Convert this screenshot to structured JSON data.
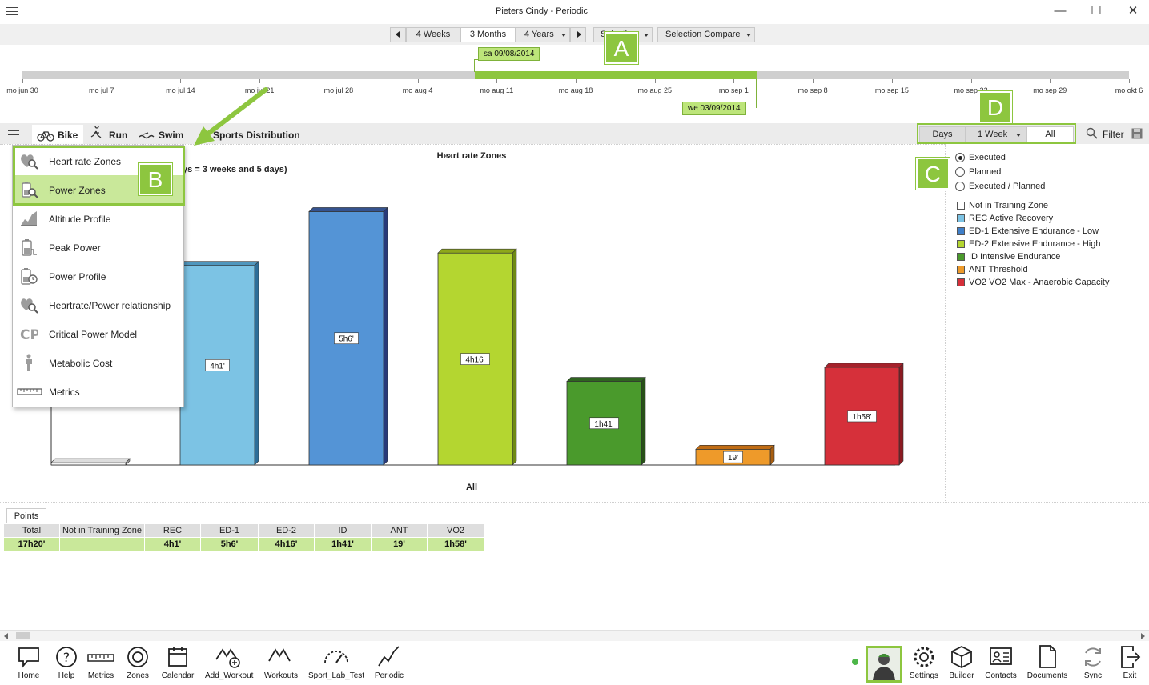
{
  "window": {
    "title": "Pieters Cindy - Periodic"
  },
  "range": {
    "segments": [
      "4 Weeks",
      "3 Months",
      "4 Years"
    ],
    "select_label": "Selection",
    "compare_label": "Selection Compare"
  },
  "timeline": {
    "start_date": "sa 09/08/2014",
    "end_date": "we 03/09/2014",
    "ticks": [
      "mo jun 30",
      "mo jul 7",
      "mo jul 14",
      "mo jul 21",
      "mo jul 28",
      "mo aug 4",
      "mo aug 11",
      "mo aug 18",
      "mo aug 25",
      "mo sep 1",
      "mo sep 8",
      "mo sep 15",
      "mo sep 22",
      "mo sep 29",
      "mo okt 6"
    ]
  },
  "callouts": {
    "a": "A",
    "b": "B",
    "c": "C",
    "d": "D"
  },
  "tabs": {
    "bike": "Bike",
    "run": "Run",
    "swim": "Swim",
    "sports": "Sports Distribution"
  },
  "grouping": {
    "days": "Days",
    "week": "1 Week",
    "all": "All",
    "filter": "Filter"
  },
  "menu": {
    "items": [
      {
        "label": "Heart rate Zones",
        "icon": "heart-magnifier-icon"
      },
      {
        "label": "Power Zones",
        "icon": "battery-magnifier-icon"
      },
      {
        "label": "Altitude Profile",
        "icon": "altitude-chart-icon"
      },
      {
        "label": "Peak Power",
        "icon": "battery-peak-icon"
      },
      {
        "label": "Power Profile",
        "icon": "battery-clock-icon"
      },
      {
        "label": "Heartrate/Power relationship",
        "icon": "heart-power-icon"
      },
      {
        "label": "Critical Power Model",
        "icon": "cp-icon"
      },
      {
        "label": "Metabolic Cost",
        "icon": "person-icon"
      },
      {
        "label": "Metrics",
        "icon": "ruler-icon"
      }
    ]
  },
  "chart_data": {
    "type": "bar",
    "title": "Heart rate Zones",
    "subtitle": "ys = 3 weeks and 5 days)",
    "xlabel": "All",
    "ylabel": "",
    "categories": [
      "Not in Training Zone",
      "REC",
      "ED-1",
      "ED-2",
      "ID",
      "ANT",
      "VO2"
    ],
    "values": [
      0,
      241,
      306,
      256,
      101,
      19,
      118
    ],
    "value_labels": [
      "",
      "4h1'",
      "5h6'",
      "4h16'",
      "1h41'",
      "19'",
      "1h58'"
    ],
    "colors": [
      "#f4f4f4",
      "#7cc3e4",
      "#5494d6",
      "#b4d630",
      "#4a9a2c",
      "#ee9a2a",
      "#d6303a"
    ],
    "side_colors": [
      "#999999",
      "#2d6e99",
      "#283a7a",
      "#6f8a14",
      "#285018",
      "#a85e10",
      "#8c1a22"
    ],
    "top_colors": [
      "#dddddd",
      "#4f96bd",
      "#35538f",
      "#8ea81a",
      "#2f6420",
      "#c06c14",
      "#a6212b"
    ],
    "ylim": [
      0,
      320
    ],
    "grid": false,
    "legend_position": "right"
  },
  "view_options": {
    "executed": "Executed",
    "planned": "Planned",
    "executed_planned": "Executed / Planned"
  },
  "legend": [
    {
      "label": "Not in Training Zone",
      "color": "#ffffff"
    },
    {
      "label": "REC Active Recovery",
      "color": "#7cc3e4"
    },
    {
      "label": "ED-1 Extensive Endurance - Low",
      "color": "#3f7fc9"
    },
    {
      "label": "ED-2 Extensive Endurance - High",
      "color": "#b4d630"
    },
    {
      "label": "ID Intensive Endurance",
      "color": "#4a9a2c"
    },
    {
      "label": "ANT Threshold",
      "color": "#ee9a2a"
    },
    {
      "label": "VO2 VO2 Max - Anaerobic Capacity",
      "color": "#d6303a"
    }
  ],
  "points": {
    "tab": "Points",
    "headers": [
      "Total",
      "Not in Training Zone",
      "REC",
      "ED-1",
      "ED-2",
      "ID",
      "ANT",
      "VO2"
    ],
    "values": [
      "17h20'",
      "",
      "4h1'",
      "5h6'",
      "4h16'",
      "1h41'",
      "19'",
      "1h58'"
    ]
  },
  "bottom_nav": [
    "Home",
    "Help",
    "Metrics",
    "Zones",
    "Calendar",
    "Add_Workout",
    "Workouts",
    "Sport_Lab_Test",
    "Periodic"
  ],
  "bottom_right": [
    "Settings",
    "Builder",
    "Contacts",
    "Documents",
    "Sync",
    "Exit"
  ]
}
